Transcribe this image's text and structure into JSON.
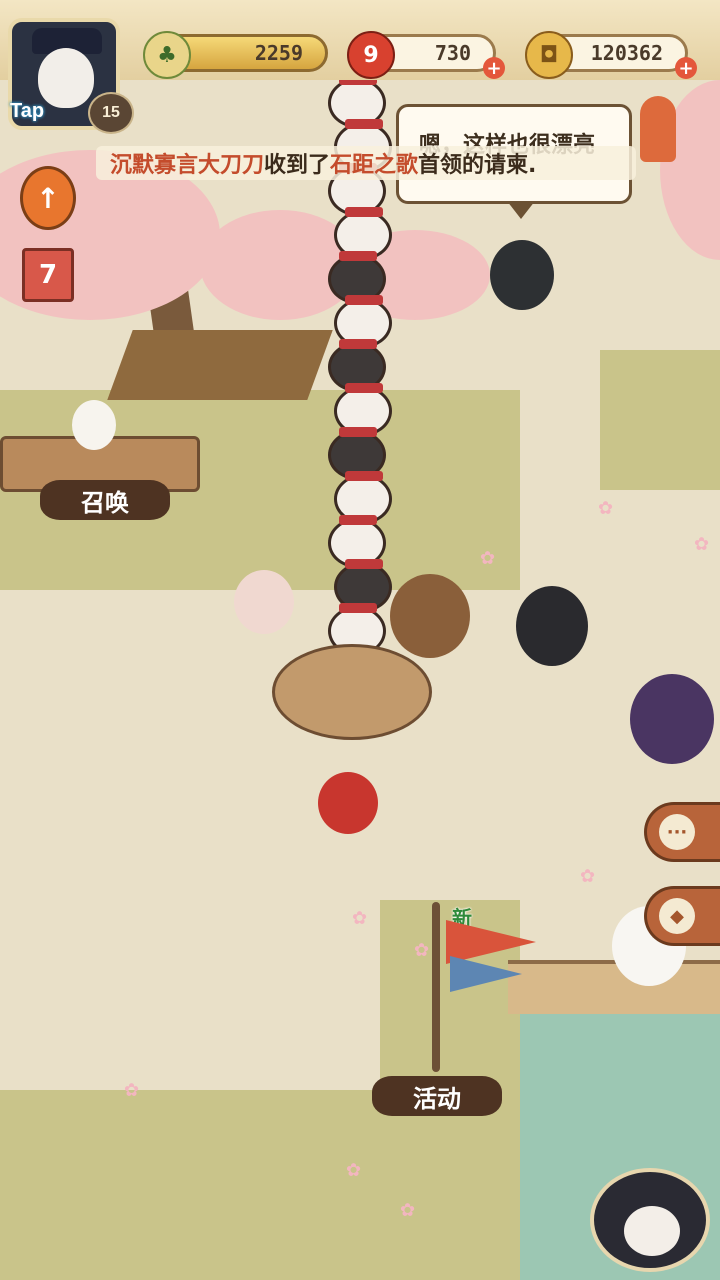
{
  "player": {
    "tap_label": "Tap",
    "level": "15"
  },
  "resources": {
    "jade": {
      "value": "2259",
      "icon": "pine-jade-icon"
    },
    "magatama": {
      "value": "730",
      "icon": "magatama-icon",
      "badge": "9"
    },
    "coins": {
      "value": "120362",
      "icon": "coin-icon"
    }
  },
  "speech_bubble": {
    "text": "嗯，这样也很漂亮"
  },
  "notice": {
    "parts": [
      "沉默寡言大刀刀",
      "收到了",
      "石距之歌",
      "首领的请柬."
    ]
  },
  "calendar_day": "7",
  "signs": {
    "summon": "召唤",
    "event": "活动"
  },
  "new_tag": "新",
  "colors": {
    "accent": "#e4573b",
    "wood": "#4e3322",
    "gold": "#d6a53f"
  }
}
